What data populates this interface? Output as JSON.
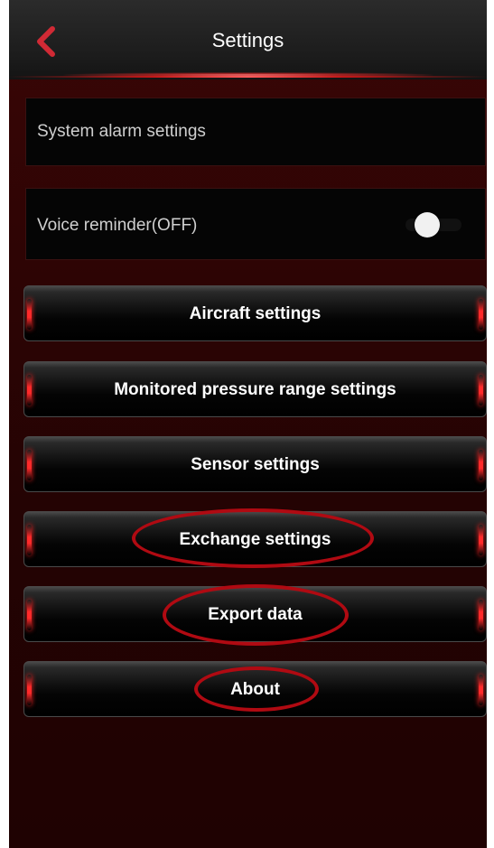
{
  "header": {
    "title": "Settings",
    "back_icon": "chevron-left-icon",
    "accent_color": "#e0303a"
  },
  "panels": {
    "alarm_label": "System alarm settings",
    "voice_label": "Voice reminder(OFF)",
    "voice_toggle_state": "off"
  },
  "menu": {
    "items": [
      {
        "label": "Aircraft settings"
      },
      {
        "label": "Monitored pressure range settings"
      },
      {
        "label": "Sensor settings"
      },
      {
        "label": "Exchange settings"
      },
      {
        "label": "Export data"
      },
      {
        "label": "About"
      }
    ]
  },
  "annotations": {
    "highlight_color": "#b00a12",
    "highlighted_items": [
      "Exchange settings",
      "Export data",
      "About"
    ]
  }
}
